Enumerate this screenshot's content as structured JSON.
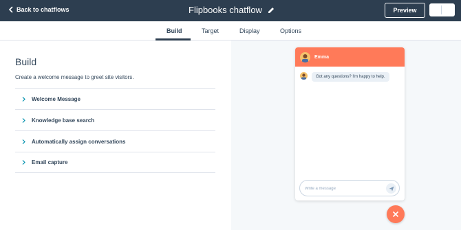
{
  "topbar": {
    "back_label": "Back to chatflows",
    "title": "Flipbooks chatflow",
    "preview_label": "Preview",
    "bg_color": "#2d3e50"
  },
  "tabs": [
    {
      "label": "Build",
      "active": true
    },
    {
      "label": "Target",
      "active": false
    },
    {
      "label": "Display",
      "active": false
    },
    {
      "label": "Options",
      "active": false
    }
  ],
  "build": {
    "heading": "Build",
    "description": "Create a welcome message to greet site visitors.",
    "sections": [
      {
        "label": "Welcome Message"
      },
      {
        "label": "Knowledge base search"
      },
      {
        "label": "Automatically assign conversations"
      },
      {
        "label": "Email capture"
      }
    ]
  },
  "widget": {
    "agent_name": "Emma",
    "message": "Got any questions? I'm happy to help.",
    "input_placeholder": "Write a message",
    "accent_color": "#ff7a59"
  },
  "icons": {
    "back": "chevron-left-icon",
    "edit": "pencil-icon",
    "section": "chevron-right-icon",
    "send": "paper-plane-icon",
    "close": "close-icon"
  }
}
